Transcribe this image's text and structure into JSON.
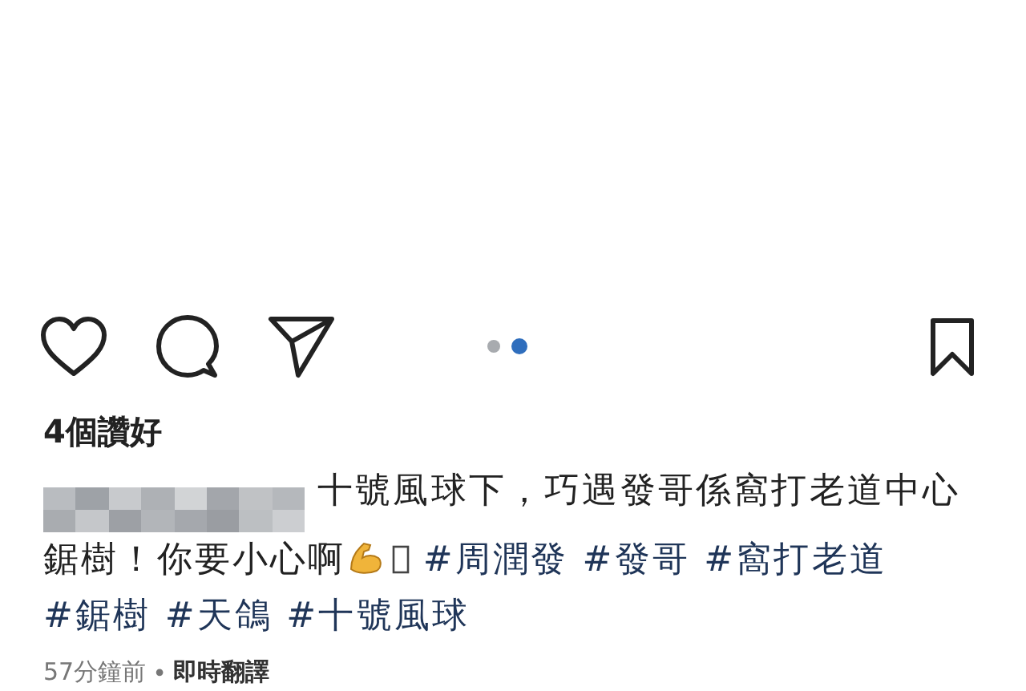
{
  "post": {
    "carousel_dots": [
      {
        "selected": false
      },
      {
        "selected": true
      }
    ],
    "likes": "4個讚好",
    "caption": {
      "text": "十號風球下，巧遇發哥係窩打老道中心鋸樹！你要小心啊",
      "hashtags": [
        "#周潤發",
        "#發哥",
        "#窩打老道",
        "#鋸樹",
        "#天鴿",
        "#十號風球"
      ]
    },
    "time": "57分鐘前",
    "separator": "•",
    "translate": "即時翻譯"
  }
}
